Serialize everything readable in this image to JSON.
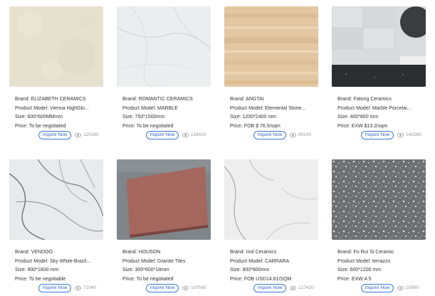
{
  "products": [
    {
      "brand": "Brand: ELIZABETH CERAMICS",
      "model": "Product Model: Vienna HighGlo...",
      "size": "Size: 600*600MMmm",
      "price": "Price: To be negotiated",
      "inquire_label": "Inquire Now",
      "views": "125260",
      "image": "beige-tile-photo"
    },
    {
      "brand": "Brand: ROMANTIC CERAMICS",
      "model": "Product Model: MARBLE",
      "size": "Size: 750*1500mm",
      "price": "Price: To be negotiated",
      "inquire_label": "Inquire Now",
      "views": "134020",
      "image": "white-marble-photo"
    },
    {
      "brand": "Brand: ANGTAI",
      "model": "Product Model: Elemental Stone...",
      "size": "Size: 1200*2400 mm",
      "price": "Price: FOB $ 76.5/sqm",
      "inquire_label": "Inquire Now",
      "views": "90240",
      "image": "travertine-photo"
    },
    {
      "brand": "Brand: Fatong Ceramics",
      "model": "Product Model: Marble Porcelai...",
      "size": "Size: 400*800 mm",
      "price": "Price: EXW $13.2/sqm",
      "inquire_label": "Inquire Now",
      "views": "142560",
      "image": "bathroom-marble-photo"
    },
    {
      "brand": "Brand: VENDOO",
      "model": "Product Model: Sky White-Brazil...",
      "size": "Size: 900*1800 mm",
      "price": "Price: To be negotiable",
      "inquire_label": "Inquire Now",
      "views": "72040",
      "image": "grey-veined-marble-photo"
    },
    {
      "brand": "Brand: HOUSON",
      "model": "Product Model: Granite Tiles",
      "size": "Size: 300*600*18mm",
      "price": "Price: To be negotiated",
      "inquire_label": "Inquire Now",
      "views": "107560",
      "image": "red-granite-tile-photo"
    },
    {
      "brand": "Brand: Inol Ceramics",
      "model": "Product Model: CARRARA",
      "size": "Size: 800*800mm",
      "price": "Price: FOB USD14.81/SQM",
      "inquire_label": "Inquire Now",
      "views": "127420",
      "image": "carrara-marble-photo"
    },
    {
      "brand": "Brand: Fo Rui Si Ceramic",
      "model": "Product Model: terrazzo",
      "size": "Size: 600*1200 mm",
      "price": "Price: EXW 4.5",
      "inquire_label": "Inquire Now",
      "views": "10960",
      "image": "terrazzo-photo"
    }
  ],
  "colors": {
    "accent": "#3a78d6",
    "text": "#333333",
    "muted": "#999999"
  },
  "icons": {
    "views": "eye-icon"
  }
}
